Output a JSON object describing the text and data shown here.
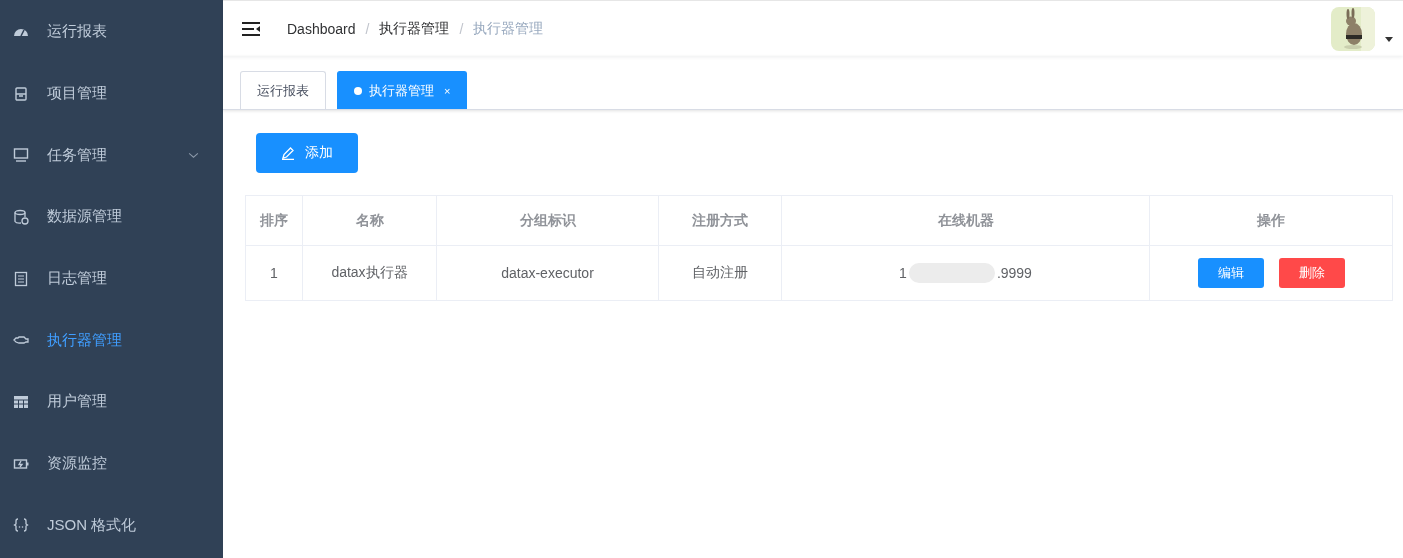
{
  "sidebar": {
    "items": [
      {
        "label": "运行报表",
        "selected": false
      },
      {
        "label": "项目管理",
        "selected": false
      },
      {
        "label": "任务管理",
        "selected": false,
        "expandable": true
      },
      {
        "label": "数据源管理",
        "selected": false
      },
      {
        "label": "日志管理",
        "selected": false
      },
      {
        "label": "执行器管理",
        "selected": true
      },
      {
        "label": "用户管理",
        "selected": false
      },
      {
        "label": "资源监控",
        "selected": false
      },
      {
        "label": "JSON 格式化",
        "selected": false
      }
    ]
  },
  "breadcrumb": [
    {
      "label": "Dashboard",
      "current": false
    },
    {
      "separator": "/",
      "label": "执行器管理",
      "current": false
    },
    {
      "separator": "/",
      "label": "执行器管理",
      "current": true
    }
  ],
  "tabs": [
    {
      "label": "运行报表",
      "selected": false,
      "closable": false
    },
    {
      "label": "执行器管理",
      "selected": true,
      "closable": true,
      "close": "×"
    }
  ],
  "add_button": "添加",
  "table": {
    "columns": [
      "排序",
      "名称",
      "分组标识",
      "注册方式",
      "在线机器",
      "操作"
    ],
    "rows": [
      {
        "cells": [
          "1",
          "datax执行器",
          "datax-executor",
          "自动注册"
        ],
        "machine": {
          "start": "1",
          "end": ".9999",
          "redacted": true
        },
        "actions": [
          {
            "label": "编辑",
            "kind": "primary"
          },
          {
            "label": "删除",
            "kind": "danger"
          }
        ]
      }
    ]
  }
}
